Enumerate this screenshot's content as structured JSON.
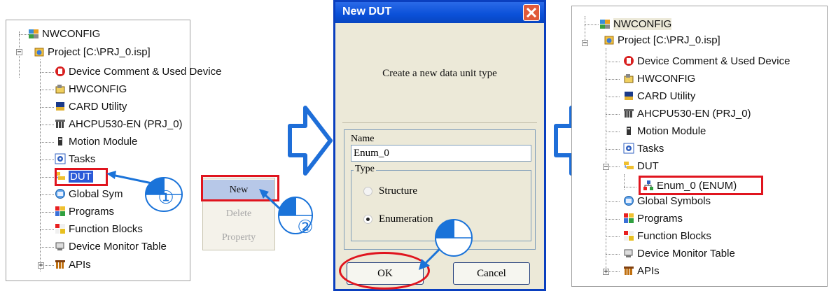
{
  "left_tree": {
    "items": [
      {
        "label": "NWCONFIG",
        "icon": "nwconfig-icon"
      },
      {
        "label": "Project [C:\\PRJ_0.isp]",
        "icon": "project-icon"
      },
      {
        "label": "Device Comment & Used Device",
        "icon": "device-comment-icon"
      },
      {
        "label": "HWCONFIG",
        "icon": "hwconfig-icon"
      },
      {
        "label": "CARD Utility",
        "icon": "card-utility-icon"
      },
      {
        "label": "AHCPU530-EN  (PRJ_0)",
        "icon": "cpu-icon"
      },
      {
        "label": "Motion Module",
        "icon": "motion-module-icon"
      },
      {
        "label": "Tasks",
        "icon": "tasks-icon"
      },
      {
        "label": "DUT",
        "icon": "dut-icon"
      },
      {
        "label": "Global Sym",
        "icon": "global-symbols-icon"
      },
      {
        "label": "Programs",
        "icon": "programs-icon"
      },
      {
        "label": "Function Blocks",
        "icon": "function-blocks-icon"
      },
      {
        "label": "Device Monitor Table",
        "icon": "device-monitor-icon"
      },
      {
        "label": "APIs",
        "icon": "apis-icon"
      }
    ]
  },
  "context_menu": {
    "items": [
      {
        "label": "New",
        "enabled": true,
        "highlighted": true
      },
      {
        "label": "Delete",
        "enabled": false
      },
      {
        "label": "Property",
        "enabled": false
      }
    ]
  },
  "dialog": {
    "title": "New DUT",
    "description": "Create a new data unit type",
    "name_label": "Name",
    "name_value": "Enum_0",
    "type_label": "Type",
    "options": [
      {
        "label": "Structure",
        "selected": false
      },
      {
        "label": "Enumeration",
        "selected": true
      }
    ],
    "ok_label": "OK",
    "cancel_label": "Cancel"
  },
  "right_tree": {
    "items": [
      {
        "label": "NWCONFIG",
        "icon": "nwconfig-icon"
      },
      {
        "label": "Project [C:\\PRJ_0.isp]",
        "icon": "project-icon"
      },
      {
        "label": "Device Comment & Used Device",
        "icon": "device-comment-icon"
      },
      {
        "label": "HWCONFIG",
        "icon": "hwconfig-icon"
      },
      {
        "label": "CARD Utility",
        "icon": "card-utility-icon"
      },
      {
        "label": "AHCPU530-EN  (PRJ_0)",
        "icon": "cpu-icon"
      },
      {
        "label": "Motion Module",
        "icon": "motion-module-icon"
      },
      {
        "label": "Tasks",
        "icon": "tasks-icon"
      },
      {
        "label": "DUT",
        "icon": "dut-icon"
      },
      {
        "label": "Enum_0 (ENUM)",
        "icon": "enum-icon"
      },
      {
        "label": "Global Symbols",
        "icon": "global-symbols-icon"
      },
      {
        "label": "Programs",
        "icon": "programs-icon"
      },
      {
        "label": "Function Blocks",
        "icon": "function-blocks-icon"
      },
      {
        "label": "Device Monitor Table",
        "icon": "device-monitor-icon"
      },
      {
        "label": "APIs",
        "icon": "apis-icon"
      }
    ]
  },
  "step_markers": [
    "①",
    "②"
  ],
  "colors": {
    "highlight": "#e0141e",
    "arrow": "#1e6ed8",
    "arrow_fill": "#ffffff",
    "dialog_title": "#0a50d8",
    "dialog_body": "#ece9d8",
    "mouse_blue": "#1a73d9"
  }
}
